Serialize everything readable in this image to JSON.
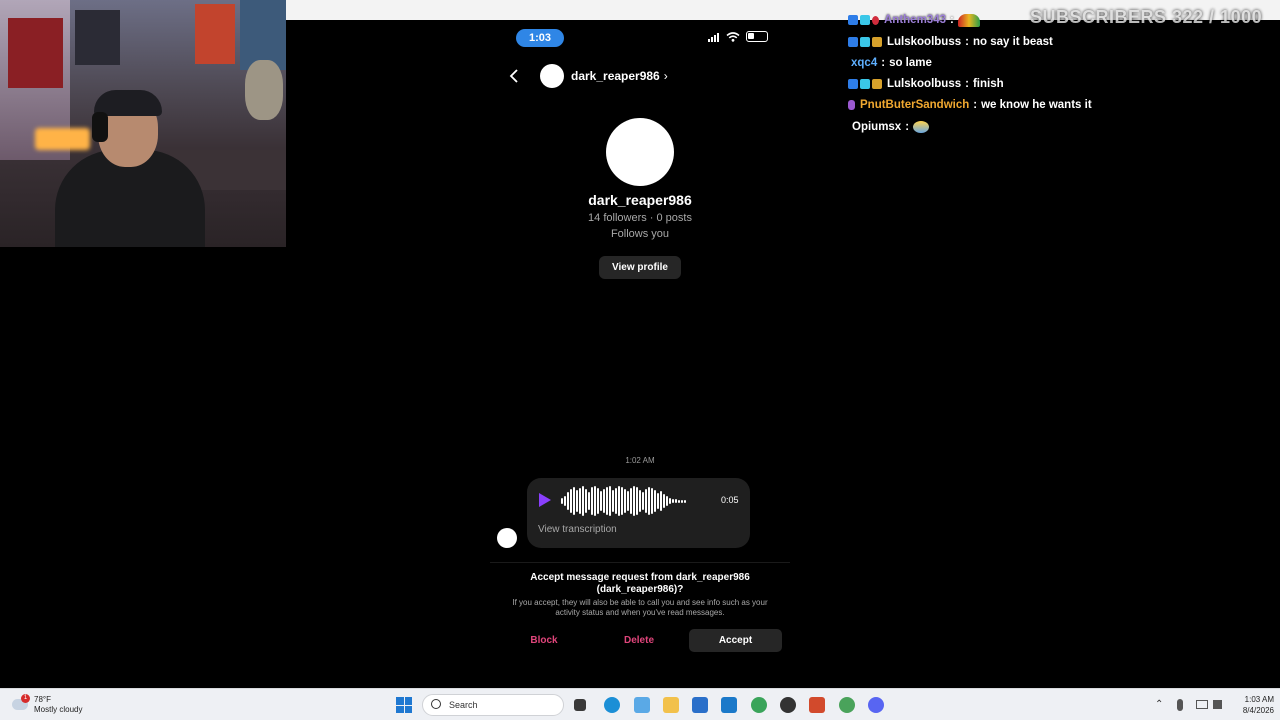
{
  "phone": {
    "status_time": "1:03",
    "header_username": "dark_reaper986",
    "profile": {
      "name": "dark_reaper986",
      "stats": "14 followers · 0 posts",
      "follows": "Follows you",
      "view_profile_label": "View profile"
    },
    "message": {
      "time": "1:02 AM",
      "duration": "0:05",
      "transcription_label": "View transcription"
    },
    "request": {
      "title": "Accept message request from dark_reaper986 (dark_reaper986)?",
      "body": "If you accept, they will also be able to call you and see info such as your activity status and when you've read messages.",
      "block_label": "Block",
      "delete_label": "Delete",
      "accept_label": "Accept"
    }
  },
  "chat": {
    "messages": [
      {
        "user": "Anthem343",
        "text": "",
        "color": "#9b7ed6"
      },
      {
        "user": "Lulskoolbuss",
        "text": "no say it beast",
        "color": "#ffffff"
      },
      {
        "user": "xqc4",
        "text": "so lame",
        "color": "#5fb0ff"
      },
      {
        "user": "Lulskoolbuss",
        "text": "finish",
        "color": "#ffffff"
      },
      {
        "user": "PnutButerSandwich",
        "text": "we know he wants it",
        "color": "#f0a830"
      },
      {
        "user": "Opiumsx",
        "text": "",
        "color": "#ffffff"
      }
    ],
    "sub_goal": "SUBSCRIBERS 322 / 1000"
  },
  "taskbar": {
    "weather_temp": "78°F",
    "weather_desc": "Mostly cloudy",
    "weather_badge": "1",
    "search_placeholder": "Search",
    "clock_time": "1:03 AM",
    "clock_date": "8/4/2026"
  },
  "colors": {
    "accent_blue": "#2f86e6",
    "danger_pink": "#e0457b",
    "play_purple": "#8a3ffc"
  }
}
